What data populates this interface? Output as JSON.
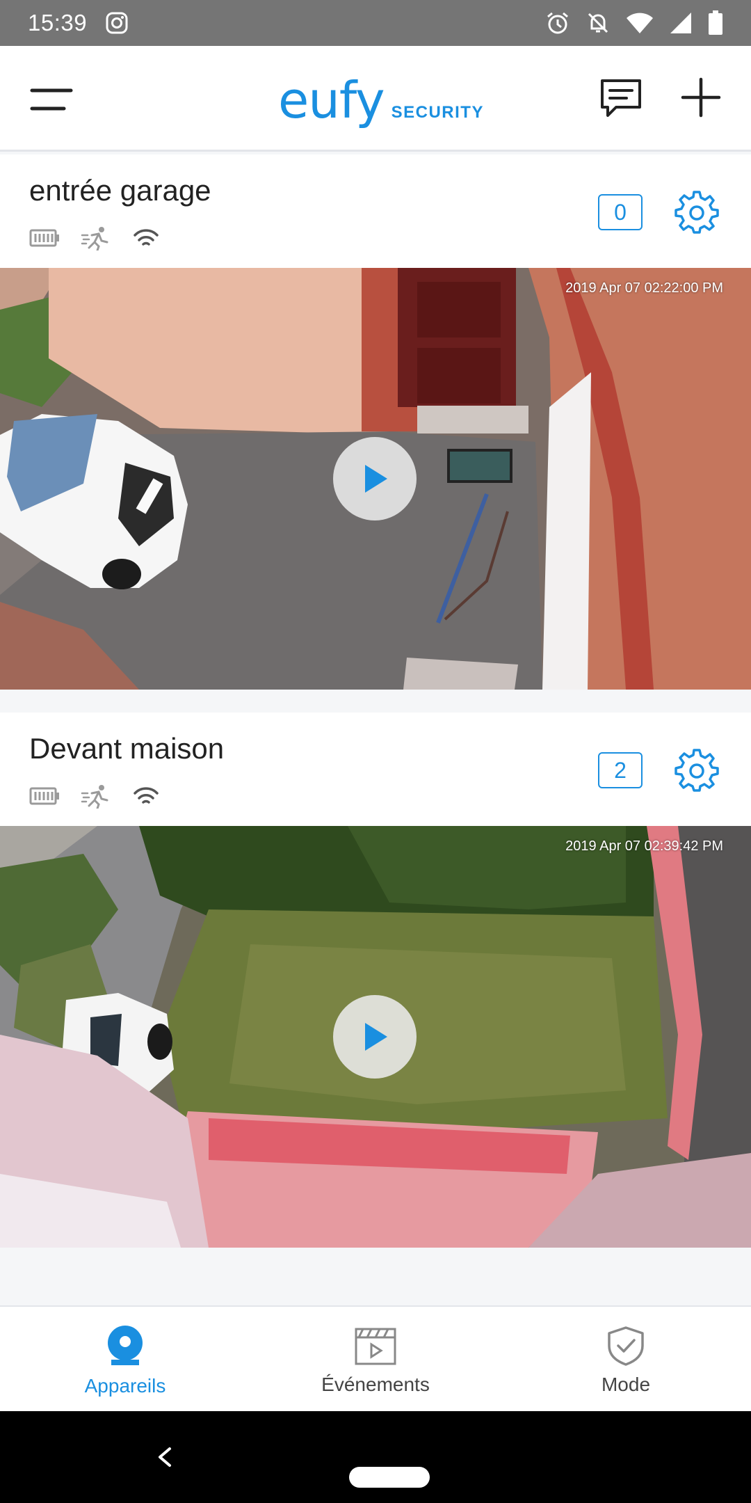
{
  "status_bar": {
    "time": "15:39",
    "icons": [
      "instagram-icon",
      "alarm-icon",
      "notifications-off-icon",
      "wifi-icon",
      "signal-icon",
      "battery-icon"
    ]
  },
  "header": {
    "logo_word": "eufy",
    "logo_suffix": "SECURITY",
    "icons": [
      "menu-icon",
      "message-icon",
      "add-icon"
    ]
  },
  "devices": [
    {
      "name": "entrée garage",
      "event_count": "0",
      "timestamp": "2019 Apr 07   02:22:00 PM",
      "status_icons": [
        "battery-icon",
        "motion-icon",
        "wifi-icon"
      ]
    },
    {
      "name": "Devant maison",
      "event_count": "2",
      "timestamp": "2019 Apr 07   02:39:42 PM",
      "status_icons": [
        "battery-icon",
        "motion-icon",
        "wifi-icon"
      ]
    }
  ],
  "bottom_nav": {
    "tabs": [
      {
        "label": "Appareils",
        "icon": "camera-icon",
        "active": true
      },
      {
        "label": "Événements",
        "icon": "clapperboard-icon",
        "active": false
      },
      {
        "label": "Mode",
        "icon": "shield-check-icon",
        "active": false
      }
    ]
  },
  "colors": {
    "accent": "#1a8fe0",
    "status_bar": "#757575",
    "background": "#f5f6f8"
  }
}
